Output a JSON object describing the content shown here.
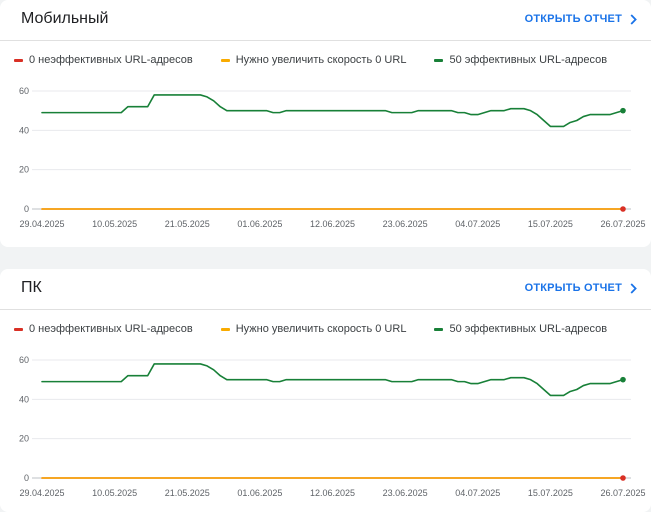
{
  "colors": {
    "none": "#d93025",
    "improve": "#f9ab00",
    "good": "#188038",
    "accent": "#1a73e8"
  },
  "cards": [
    {
      "title": "Мобильный",
      "open_report_label": "ОТКРЫТЬ ОТЧЕТ",
      "open_report_icon": "chevron-right-icon",
      "legend": [
        {
          "label": "0 неэффективных URL-адресов",
          "color": "#d93025"
        },
        {
          "label": "Нужно увеличить скорость 0 URL",
          "color": "#f9ab00"
        },
        {
          "label": "50 эффективных URL-адресов",
          "color": "#188038"
        }
      ]
    },
    {
      "title": "ПК",
      "open_report_label": "ОТКРЫТЬ ОТЧЕТ",
      "open_report_icon": "chevron-right-icon",
      "legend": [
        {
          "label": "0 неэффективных URL-адресов",
          "color": "#d93025"
        },
        {
          "label": "Нужно увеличить скорость 0 URL",
          "color": "#f9ab00"
        },
        {
          "label": "50 эффективных URL-адресов",
          "color": "#188038"
        }
      ]
    }
  ],
  "chart_data": [
    {
      "type": "line",
      "title": "Мобильный",
      "x_ticks": [
        "29.04.2025",
        "10.05.2025",
        "21.05.2025",
        "01.06.2025",
        "12.06.2025",
        "23.06.2025",
        "04.07.2025",
        "15.07.2025",
        "26.07.2025"
      ],
      "y_ticks": [
        0,
        20,
        40,
        60
      ],
      "ylim": [
        0,
        60
      ],
      "xlim": [
        "29.04.2025",
        "26.07.2025"
      ],
      "grid": true,
      "legend_position": "top",
      "series": [
        {
          "name": "0 неэффективных URL-адресов",
          "color": "#d93025",
          "x": [
            "29.04.2025",
            "26.07.2025"
          ],
          "y": [
            0,
            0
          ]
        },
        {
          "name": "Нужно увеличить скорость 0 URL",
          "color": "#f9ab00",
          "x": [
            "29.04.2025",
            "26.07.2025"
          ],
          "y": [
            0,
            0
          ]
        },
        {
          "name": "50 эффективных URL-адресов",
          "color": "#188038",
          "x": [
            "29.04.2025",
            "11.05.2025",
            "12.05.2025",
            "15.05.2025",
            "16.05.2025",
            "23.05.2025",
            "24.05.2025",
            "25.05.2025",
            "26.05.2025",
            "27.05.2025",
            "02.06.2025",
            "03.06.2025",
            "04.06.2025",
            "05.06.2025",
            "20.06.2025",
            "21.06.2025",
            "24.06.2025",
            "25.06.2025",
            "30.06.2025",
            "01.07.2025",
            "02.07.2025",
            "03.07.2025",
            "04.07.2025",
            "05.07.2025",
            "06.07.2025",
            "08.07.2025",
            "09.07.2025",
            "11.07.2025",
            "12.07.2025",
            "13.07.2025",
            "14.07.2025",
            "15.07.2025",
            "17.07.2025",
            "18.07.2025",
            "19.07.2025",
            "20.07.2025",
            "21.07.2025",
            "24.07.2025",
            "25.07.2025",
            "26.07.2025"
          ],
          "y": [
            49,
            49,
            52,
            52,
            58,
            58,
            57,
            55,
            52,
            50,
            50,
            49,
            49,
            50,
            50,
            49,
            49,
            50,
            50,
            49,
            49,
            48,
            48,
            49,
            50,
            50,
            51,
            51,
            50,
            48,
            45,
            42,
            42,
            44,
            45,
            47,
            48,
            48,
            49,
            50
          ]
        }
      ]
    },
    {
      "type": "line",
      "title": "ПК",
      "x_ticks": [
        "29.04.2025",
        "10.05.2025",
        "21.05.2025",
        "01.06.2025",
        "12.06.2025",
        "23.06.2025",
        "04.07.2025",
        "15.07.2025",
        "26.07.2025"
      ],
      "y_ticks": [
        0,
        20,
        40,
        60
      ],
      "ylim": [
        0,
        60
      ],
      "xlim": [
        "29.04.2025",
        "26.07.2025"
      ],
      "grid": true,
      "legend_position": "top",
      "series": [
        {
          "name": "0 неэффективных URL-адресов",
          "color": "#d93025",
          "x": [
            "29.04.2025",
            "26.07.2025"
          ],
          "y": [
            0,
            0
          ]
        },
        {
          "name": "Нужно увеличить скорость 0 URL",
          "color": "#f9ab00",
          "x": [
            "29.04.2025",
            "26.07.2025"
          ],
          "y": [
            0,
            0
          ]
        },
        {
          "name": "50 эффективных URL-адресов",
          "color": "#188038",
          "x": [
            "29.04.2025",
            "11.05.2025",
            "12.05.2025",
            "15.05.2025",
            "16.05.2025",
            "23.05.2025",
            "24.05.2025",
            "25.05.2025",
            "26.05.2025",
            "27.05.2025",
            "02.06.2025",
            "03.06.2025",
            "04.06.2025",
            "05.06.2025",
            "20.06.2025",
            "21.06.2025",
            "24.06.2025",
            "25.06.2025",
            "30.06.2025",
            "01.07.2025",
            "02.07.2025",
            "03.07.2025",
            "04.07.2025",
            "05.07.2025",
            "06.07.2025",
            "08.07.2025",
            "09.07.2025",
            "11.07.2025",
            "12.07.2025",
            "13.07.2025",
            "14.07.2025",
            "15.07.2025",
            "17.07.2025",
            "18.07.2025",
            "19.07.2025",
            "20.07.2025",
            "21.07.2025",
            "24.07.2025",
            "25.07.2025",
            "26.07.2025"
          ],
          "y": [
            49,
            49,
            52,
            52,
            58,
            58,
            57,
            55,
            52,
            50,
            50,
            49,
            49,
            50,
            50,
            49,
            49,
            50,
            50,
            49,
            49,
            48,
            48,
            49,
            50,
            50,
            51,
            51,
            50,
            48,
            45,
            42,
            42,
            44,
            45,
            47,
            48,
            48,
            49,
            50
          ]
        }
      ]
    }
  ]
}
